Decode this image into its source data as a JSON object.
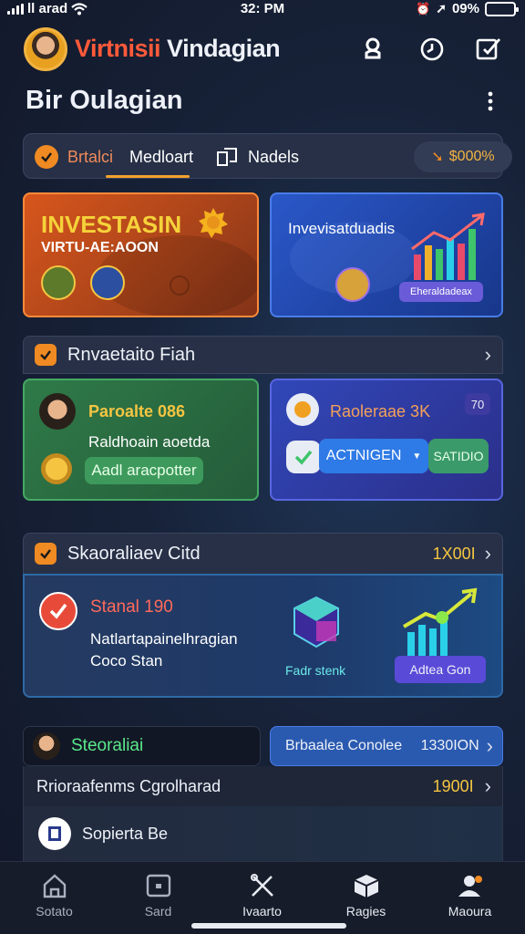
{
  "status": {
    "carrier": "ll arad",
    "time": "32: PM",
    "battery": "09%"
  },
  "header": {
    "brand_accent": "Virtnisii",
    "brand_rest": " Vindagian",
    "page_title": "Bir Oulagian"
  },
  "tabs": [
    {
      "label": "Brtalci"
    },
    {
      "label": "Medloart"
    },
    {
      "label": "Nadels"
    }
  ],
  "balance_pill": "$000%",
  "promo": {
    "title": "INVESTASIN",
    "subtitle": "VIRTU-AE:AOON",
    "right_title": "Invevisatduadis",
    "right_badge": "Eheraldadeax"
  },
  "section1": {
    "title": "Rnvaetaito Fiah",
    "card_left": {
      "title": "Paroalte 086",
      "text": "Raldhoain aoetda",
      "button": "Aadl aracpotter"
    },
    "card_right": {
      "title": "Raoleraae 3K",
      "badge": "70",
      "button": "ACTNIGEN",
      "value": "SATIDIO"
    }
  },
  "section2": {
    "title": "Skaoraliaev Citd",
    "value": "1X00I",
    "status": "Stanal 190",
    "line1": "Natlartapainelhragian",
    "line2": "Coco Stan",
    "label_left": "Fadr stenk",
    "button": "Adtea Gon"
  },
  "section3": {
    "left_title": "Steoraliai",
    "right_title": "Brbaalea Conolee",
    "right_value": "1330ION",
    "row_title": "Rrioraafenms Cgrolharad",
    "row_value": "1900I",
    "item": "Sopierta Be"
  },
  "bottom_nav": [
    {
      "label": "Sotato",
      "icon": "home-icon"
    },
    {
      "label": "Sard",
      "icon": "wallet-icon"
    },
    {
      "label": "Ivaarto",
      "icon": "tools-icon"
    },
    {
      "label": "Ragies",
      "icon": "cube-icon"
    },
    {
      "label": "Maoura",
      "icon": "profile-icon"
    }
  ],
  "colors": {
    "accent": "#f08a22",
    "background": "#141a2c",
    "card_orange": "#d7561c",
    "card_blue": "#2a58c8",
    "card_green": "#2f7a48",
    "positive": "#45a864"
  }
}
